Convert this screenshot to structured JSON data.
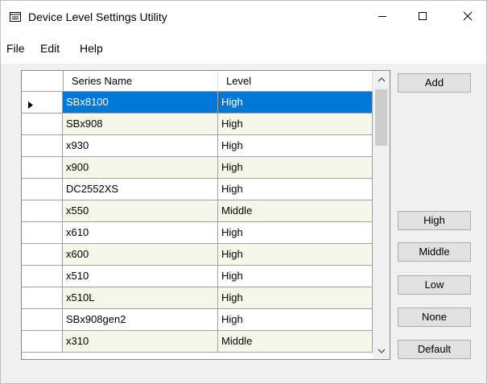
{
  "window": {
    "title": "Device Level Settings Utility",
    "icon": "window-app-icon"
  },
  "window_controls": {
    "minimize_icon": "minimize-icon",
    "maximize_icon": "maximize-icon",
    "close_icon": "close-icon"
  },
  "menu": [
    {
      "label": "File"
    },
    {
      "label": "Edit"
    },
    {
      "label": "Help"
    }
  ],
  "grid": {
    "columns": [
      {
        "label": "Series Name"
      },
      {
        "label": "Level"
      }
    ],
    "current_row_icon": "row-pointer-icon",
    "rows": [
      {
        "name": "SBx8100",
        "level": "High",
        "selected": true
      },
      {
        "name": "SBx908",
        "level": "High"
      },
      {
        "name": "x930",
        "level": "High"
      },
      {
        "name": "x900",
        "level": "High"
      },
      {
        "name": "DC2552XS",
        "level": "High"
      },
      {
        "name": "x550",
        "level": "Middle"
      },
      {
        "name": "x610",
        "level": "High"
      },
      {
        "name": "x600",
        "level": "High"
      },
      {
        "name": "x510",
        "level": "High"
      },
      {
        "name": "x510L",
        "level": "High"
      },
      {
        "name": "SBx908gen2",
        "level": "High"
      },
      {
        "name": "x310",
        "level": "Middle"
      }
    ],
    "scroll_icons": {
      "up": "scroll-up-icon",
      "down": "scroll-down-icon"
    }
  },
  "buttons": {
    "add": "Add",
    "high": "High",
    "middle": "Middle",
    "low": "Low",
    "none": "None",
    "default": "Default"
  },
  "colors": {
    "selection": "#0078d7",
    "alt_row": "#f5f7e8",
    "button_face": "#e1e1e1",
    "window_bg": "#f0f0f0"
  }
}
